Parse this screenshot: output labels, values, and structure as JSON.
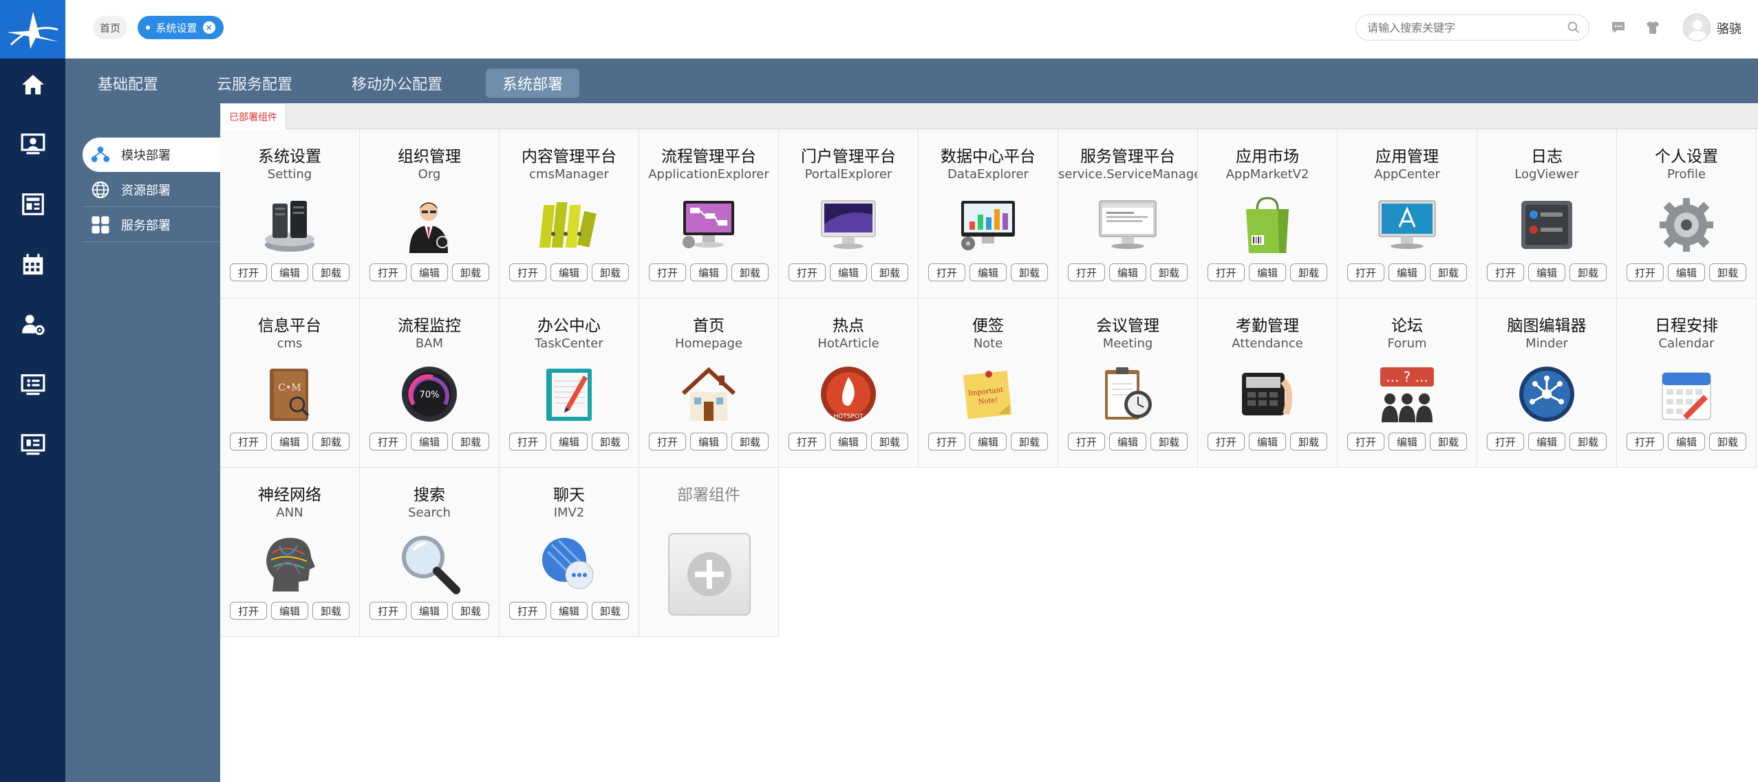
{
  "header": {
    "breadcrumb_home": "首页",
    "breadcrumb_active": "系统设置",
    "search_placeholder": "请输入搜索关键字",
    "username": "骆骁"
  },
  "tabs": [
    {
      "label": "基础配置",
      "active": false
    },
    {
      "label": "云服务配置",
      "active": false
    },
    {
      "label": "移动办公配置",
      "active": false
    },
    {
      "label": "系统部署",
      "active": true
    }
  ],
  "sidenav": [
    {
      "label": "模块部署",
      "icon": "module-nodes-icon",
      "active": true
    },
    {
      "label": "资源部署",
      "icon": "globe-icon",
      "active": false
    },
    {
      "label": "服务部署",
      "icon": "apps-grid-icon",
      "active": false
    }
  ],
  "subtab": {
    "label": "已部署组件"
  },
  "actions": {
    "open": "打开",
    "edit": "编辑",
    "unload": "卸载"
  },
  "add_card": {
    "label": "部署组件"
  },
  "components": [
    {
      "cn": "系统设置",
      "en": "Setting",
      "icon": "server-icon"
    },
    {
      "cn": "组织管理",
      "en": "Org",
      "icon": "manager-person-icon"
    },
    {
      "cn": "内容管理平台",
      "en": "cmsManager",
      "icon": "binders-icon"
    },
    {
      "cn": "流程管理平台",
      "en": "ApplicationExplorer",
      "icon": "flow-monitor-icon"
    },
    {
      "cn": "门户管理平台",
      "en": "PortalExplorer",
      "icon": "imac-icon"
    },
    {
      "cn": "数据中心平台",
      "en": "DataExplorer",
      "icon": "chart-monitor-icon"
    },
    {
      "cn": "服务管理平台",
      "en": "service.ServiceManager",
      "icon": "browser-monitor-icon"
    },
    {
      "cn": "应用市场",
      "en": "AppMarketV2",
      "icon": "shopping-bag-icon"
    },
    {
      "cn": "应用管理",
      "en": "AppCenter",
      "icon": "app-store-monitor-icon"
    },
    {
      "cn": "日志",
      "en": "LogViewer",
      "icon": "log-window-icon"
    },
    {
      "cn": "个人设置",
      "en": "Profile",
      "icon": "gear-icon"
    },
    {
      "cn": "信息平台",
      "en": "cms",
      "icon": "cm-book-icon"
    },
    {
      "cn": "流程监控",
      "en": "BAM",
      "icon": "gauge-icon"
    },
    {
      "cn": "办公中心",
      "en": "TaskCenter",
      "icon": "notebook-pen-icon"
    },
    {
      "cn": "首页",
      "en": "Homepage",
      "icon": "house-icon"
    },
    {
      "cn": "热点",
      "en": "HotArticle",
      "icon": "hotspot-icon"
    },
    {
      "cn": "便签",
      "en": "Note",
      "icon": "sticky-note-icon"
    },
    {
      "cn": "会议管理",
      "en": "Meeting",
      "icon": "clipboard-clock-icon"
    },
    {
      "cn": "考勤管理",
      "en": "Attendance",
      "icon": "fingerprint-terminal-icon"
    },
    {
      "cn": "论坛",
      "en": "Forum",
      "icon": "forum-people-icon"
    },
    {
      "cn": "脑图编辑器",
      "en": "Minder",
      "icon": "mindmap-icon"
    },
    {
      "cn": "日程安排",
      "en": "Calendar",
      "icon": "calendar-icon"
    },
    {
      "cn": "神经网络",
      "en": "ANN",
      "icon": "brain-head-icon"
    },
    {
      "cn": "搜索",
      "en": "Search",
      "icon": "magnifier-icon"
    },
    {
      "cn": "聊天",
      "en": "IMV2",
      "icon": "chat-bubble-icon"
    }
  ],
  "colors": {
    "rail": "#0f2b54",
    "band": "#4f6d8b",
    "accent": "#2b8ae6",
    "tab_active": "#6f8eab"
  }
}
